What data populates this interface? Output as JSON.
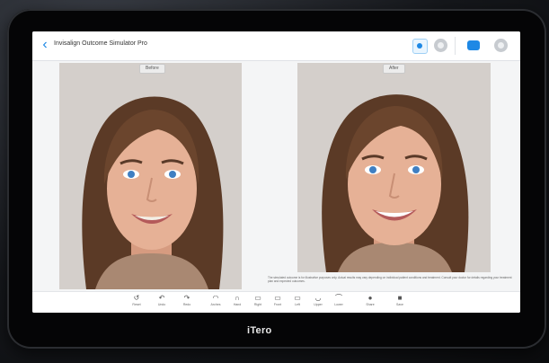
{
  "app": {
    "title": "Invisalign Outcome Simulator Pro"
  },
  "header_icons": [
    "camera-icon",
    "profile-icon",
    "dental-icon",
    "settings-icon"
  ],
  "photos": {
    "before_label": "Before",
    "after_label": "After"
  },
  "disclaimer": "The simulated outcome is for illustrative purposes only. Actual results may vary depending on individual patient conditions and treatment. Consult your doctor for details regarding your treatment plan and expected outcomes.",
  "toolbar": {
    "items": [
      {
        "label": "Reset",
        "icon": "reset-icon"
      },
      {
        "label": "Undo",
        "icon": "undo-icon"
      },
      {
        "label": "Redo",
        "icon": "redo-icon"
      },
      {
        "label": "Arches",
        "icon": "arches-icon"
      },
      {
        "label": "Hand",
        "icon": "hand-icon"
      },
      {
        "label": "Right",
        "icon": "right-icon"
      },
      {
        "label": "Front",
        "icon": "front-icon"
      },
      {
        "label": "Left",
        "icon": "left-icon"
      },
      {
        "label": "Upper",
        "icon": "upper-icon"
      },
      {
        "label": "Lower",
        "icon": "lower-icon"
      },
      {
        "label": "Share",
        "icon": "share-icon"
      },
      {
        "label": "Save",
        "icon": "save-icon"
      }
    ]
  },
  "device_logo": "iTero",
  "colors": {
    "accent": "#1e88e5",
    "bezel": "#050506",
    "screen_bg": "#f4f5f6"
  }
}
